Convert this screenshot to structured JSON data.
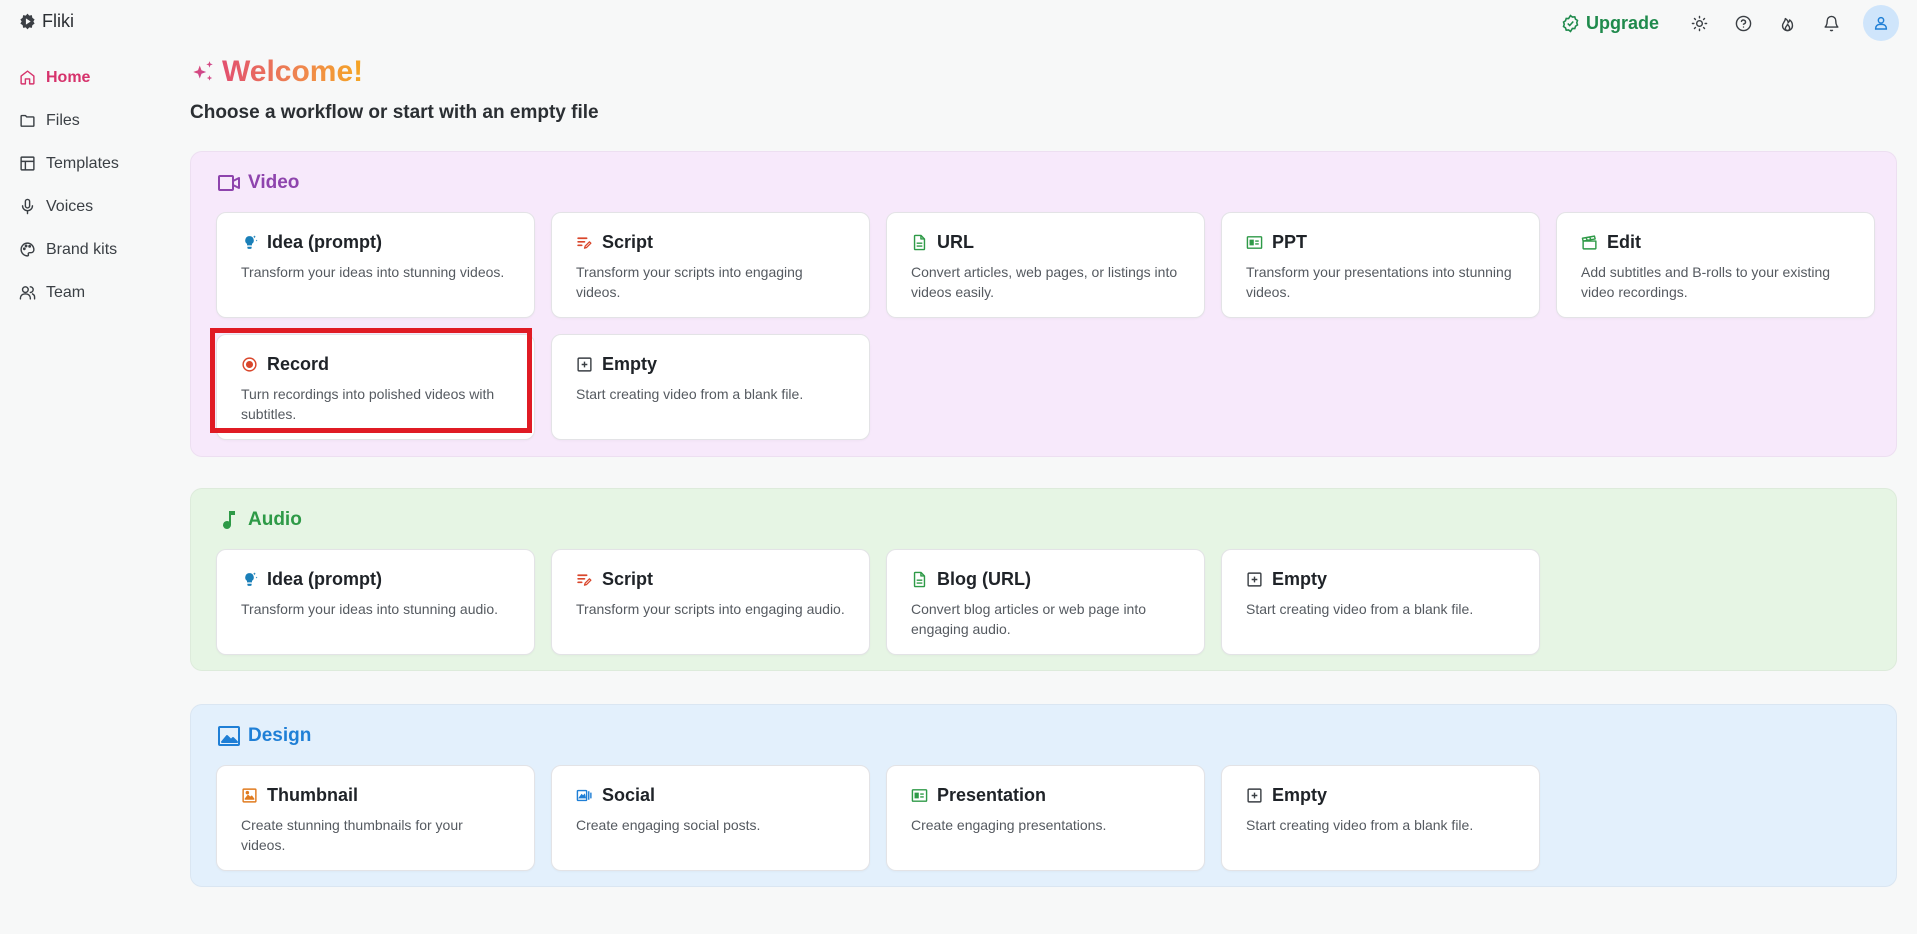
{
  "app": {
    "name": "Fliki"
  },
  "header": {
    "upgrade_label": "Upgrade",
    "icons": [
      "theme-icon",
      "help-icon",
      "flame-icon",
      "bell-icon",
      "user-icon"
    ]
  },
  "sidebar": {
    "items": [
      {
        "label": "Home",
        "icon": "home-icon",
        "active": true
      },
      {
        "label": "Files",
        "icon": "folder-icon"
      },
      {
        "label": "Templates",
        "icon": "layout-icon"
      },
      {
        "label": "Voices",
        "icon": "microphone-icon"
      },
      {
        "label": "Brand kits",
        "icon": "palette-icon"
      },
      {
        "label": "Team",
        "icon": "team-icon"
      }
    ]
  },
  "main": {
    "title": "Welcome!",
    "subtitle": "Choose a workflow or start with an empty file"
  },
  "sections": {
    "video": {
      "title": "Video",
      "cards": [
        {
          "title": "Idea (prompt)",
          "desc": "Transform your ideas into stunning videos."
        },
        {
          "title": "Script",
          "desc": "Transform your scripts into engaging videos."
        },
        {
          "title": "URL",
          "desc": "Convert articles, web pages, or listings into videos easily."
        },
        {
          "title": "PPT",
          "desc": "Transform your presentations into stunning videos."
        },
        {
          "title": "Edit",
          "desc": "Add subtitles and B-rolls to your existing video recordings."
        },
        {
          "title": "Record",
          "desc": "Turn recordings into polished videos with subtitles."
        },
        {
          "title": "Empty",
          "desc": "Start creating video from a blank file."
        }
      ]
    },
    "audio": {
      "title": "Audio",
      "cards": [
        {
          "title": "Idea (prompt)",
          "desc": "Transform your ideas into stunning audio."
        },
        {
          "title": "Script",
          "desc": "Transform your scripts into engaging audio."
        },
        {
          "title": "Blog (URL)",
          "desc": "Convert blog articles or web page into engaging audio."
        },
        {
          "title": "Empty",
          "desc": "Start creating video from a blank file."
        }
      ]
    },
    "design": {
      "title": "Design",
      "cards": [
        {
          "title": "Thumbnail",
          "desc": "Create stunning thumbnails for your videos."
        },
        {
          "title": "Social",
          "desc": "Create engaging social posts."
        },
        {
          "title": "Presentation",
          "desc": "Create engaging presentations."
        },
        {
          "title": "Empty",
          "desc": "Start creating video from a blank file."
        }
      ]
    }
  },
  "colors": {
    "accent_pink": "#d6336c",
    "upgrade_green": "#1f8a4c",
    "highlight_red": "#e01b24",
    "video_bg": "#f7e9fb",
    "audio_bg": "#e6f5e4",
    "design_bg": "#e3f0fc"
  }
}
